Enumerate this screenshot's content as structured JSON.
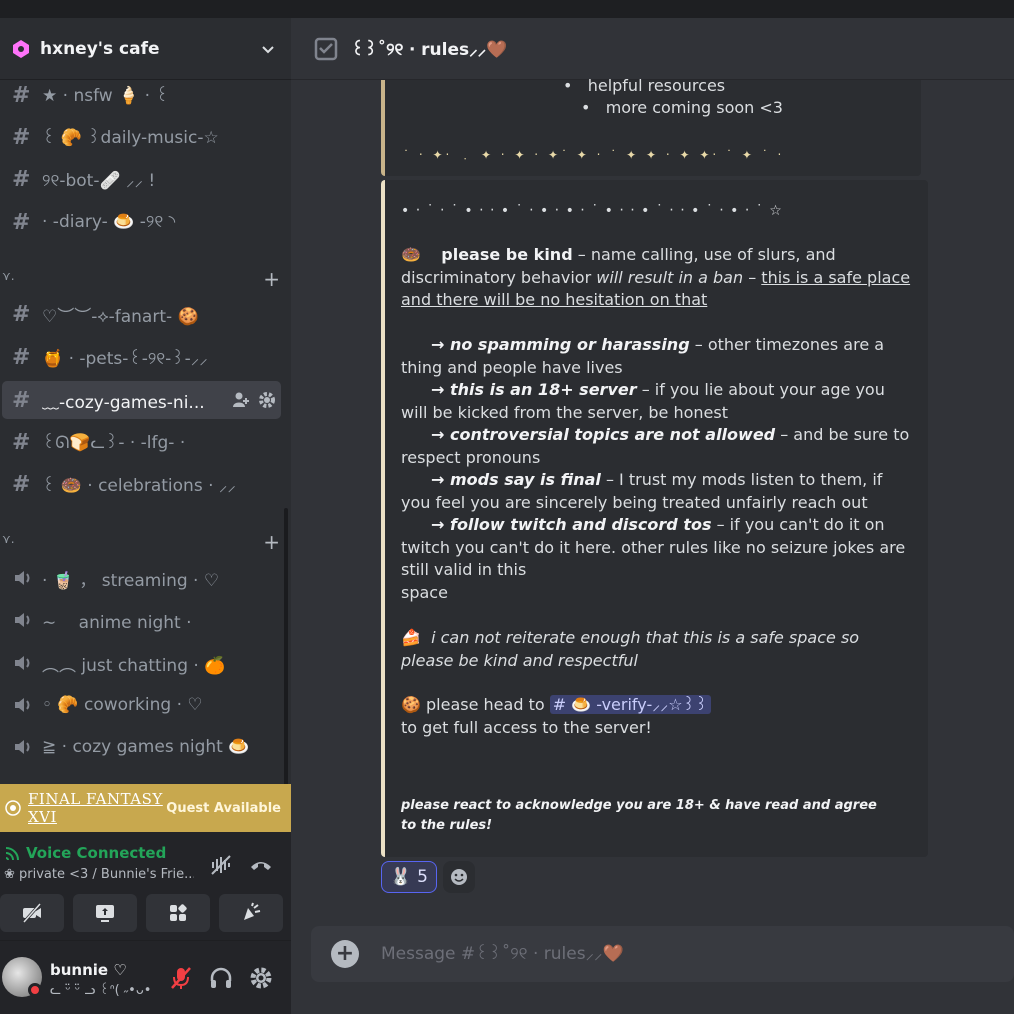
{
  "server": {
    "name": "hxney's cafe"
  },
  "channels_top": [
    {
      "label": "★ ‧ nsfw 🍦 ‧ ꒰"
    },
    {
      "label": "꒰ 🥐 ꒱daily-music-☆"
    },
    {
      "label": "୨୧-bot-🩹 ⸝⸝ !"
    },
    {
      "label": "‧ -diary- 🍮 -୨୧ ◝"
    }
  ],
  "channels_mid": [
    {
      "label": "♡︶︶-⟡-fanart- 🍪"
    },
    {
      "label": "🍯 ‧ -pets-꒰-୨୧-꒱-⸝⸝"
    },
    {
      "label": "﹏-cozy-games-ni..."
    },
    {
      "label": "꒰ᘏ🍞ᓚ꒱- ‧ -lfg- ‧"
    },
    {
      "label": "꒰ 🍩 ‧ celebrations ‧ ⸝⸝"
    }
  ],
  "voice_channels": [
    {
      "label": "‧ 🧋 ， streaming ‧ ♡"
    },
    {
      "label": "∼ 　anime night ‧"
    },
    {
      "label": "︵︵ just chatting ‧ 🍊"
    },
    {
      "label": "◦ 🥐 coworking ‧ ♡"
    },
    {
      "label": "≧ ‧ cozy games night 🍮"
    }
  ],
  "categories": {
    "a": "⋎.",
    "b": "⋎."
  },
  "quest": {
    "game": "FINAL FANTASY XVI",
    "label": "Quest Available"
  },
  "voice": {
    "title": "Voice Connected",
    "channel": "❀ private <3 / Bunnie's Frie..."
  },
  "user": {
    "name": "bunnie ♡",
    "status": "ᓚ ᵕ̈ ᵕ̈ ᓗ ꒰ᐢ( ˶•ᴗ•"
  },
  "header": {
    "title": "꒰꒱˚୨୧ ‧ rules⸝⸝🤎"
  },
  "embed1": {
    "bullet1": "helpful resources",
    "bullet2": "more coming soon <3",
    "stars": "˙ ‧ ✦‧ ﹒ ✦ ‧ ✦ ‧ ✦˙ ✦ ‧ ˙ ✦ ✦ ‧ ✦ ✦‧ ˙ ✦ ˙ ‧"
  },
  "rules": {
    "dots": "• ‧ ˙ ‧ ˙ • ‧ ‧ • ˙ ‧ • ‧ • ‧ ˙ • ‧ ‧ • ˙ ‧ ‧ • ˙ ‧ • ‧ ˙ ☆",
    "r1_bold": "please be kind",
    "r1_a": " – name calling, use of slurs, and discriminatory behavior ",
    "r1_it": "will result in a ban",
    "r1_b": " – ",
    "r1_u": "this is a safe place and there will be no hesitation on that",
    "r2_bold": "→ no spamming or harassing",
    "r2_rest": " – other timezones are a thing and people have lives",
    "r3_bold": "→ this is an 18+ server",
    "r3_rest": " – if you lie about your age you will be kicked from the server, be honest",
    "r4_bold": "→ controversial topics are not allowed",
    "r4_rest": " – and be sure to respect pronouns",
    "r5_bold": "→ mods say is final",
    "r5_rest": " – I trust my mods listen to them, if you feel you are sincerely being treated unfairly reach out",
    "r6_bold": "→ follow twitch and discord tos",
    "r6_rest": " – if you can't do it on twitch you can't do it here. other rules like no seizure jokes are still valid in this",
    "r6_tail": "space",
    "kind": "i can not reiterate enough that this is a safe space so please be kind and respectful",
    "head_to": "please head to",
    "verify": "# 🍮 -verify-⸝⸝☆꒱꒱",
    "access": "to get full access to the server!",
    "react1": "please react to acknowledge you are 18+ & have read and agree",
    "react2": "to the rules!"
  },
  "reaction": {
    "count": "5"
  },
  "composer": {
    "placeholder": "Message #꒰꒱˚୨୧ ‧ rules⸝⸝🤎"
  },
  "colors": {
    "accent": "#5865f2",
    "voice_green": "#23a559",
    "quest_gold": "#c8a84e",
    "dnd_red": "#f23f43"
  }
}
